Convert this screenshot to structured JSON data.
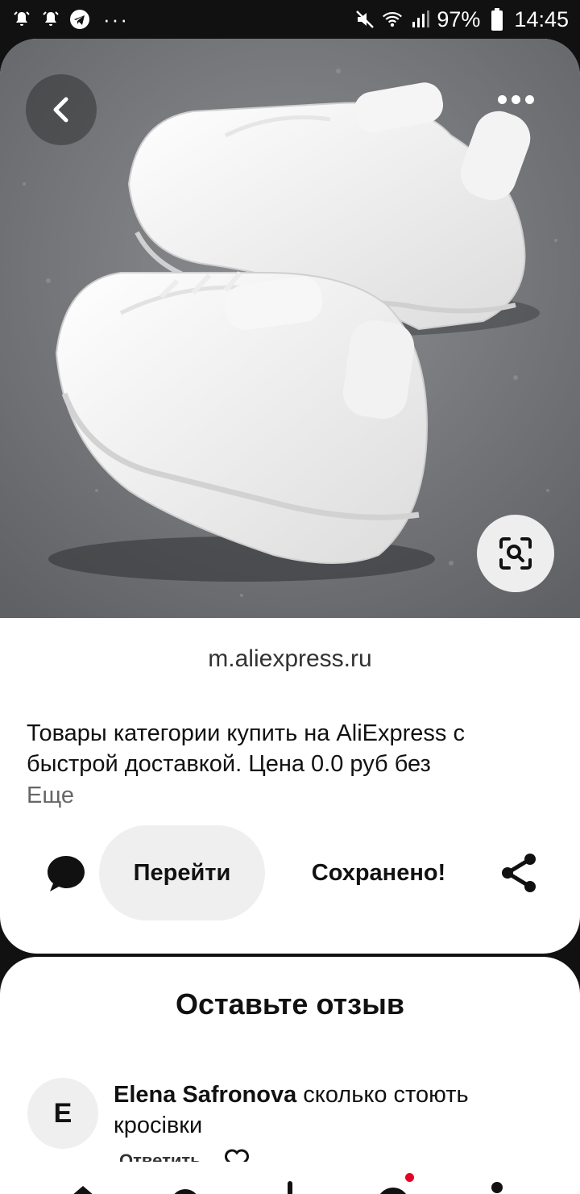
{
  "status_bar": {
    "battery": "97%",
    "time": "14:45",
    "left_icons": [
      "alarm-icon",
      "alarm-icon",
      "telegram-icon",
      "more-notifications-icon"
    ],
    "right_icons": [
      "mute-icon",
      "wifi-icon",
      "signal-icon",
      "battery-icon"
    ]
  },
  "pin": {
    "image_subject": "white sneakers on asphalt",
    "source_domain": "m.aliexpress.ru",
    "description": "Товары категории  купить на AliExpress с быстрой доставкой. Цена 0.0 руб без",
    "more_label": "Еще",
    "visit_label": "Перейти",
    "saved_label": "Сохранено!"
  },
  "comments": {
    "title": "Оставьте отзыв",
    "items": [
      {
        "avatar_letter": "E",
        "author": "Elena Safronova",
        "text": " сколько стоють кросівки",
        "reply_label": "Ответить"
      }
    ]
  },
  "colors": {
    "accent_red": "#e60023",
    "button_gray": "#efefef",
    "background_dark": "#111111"
  }
}
